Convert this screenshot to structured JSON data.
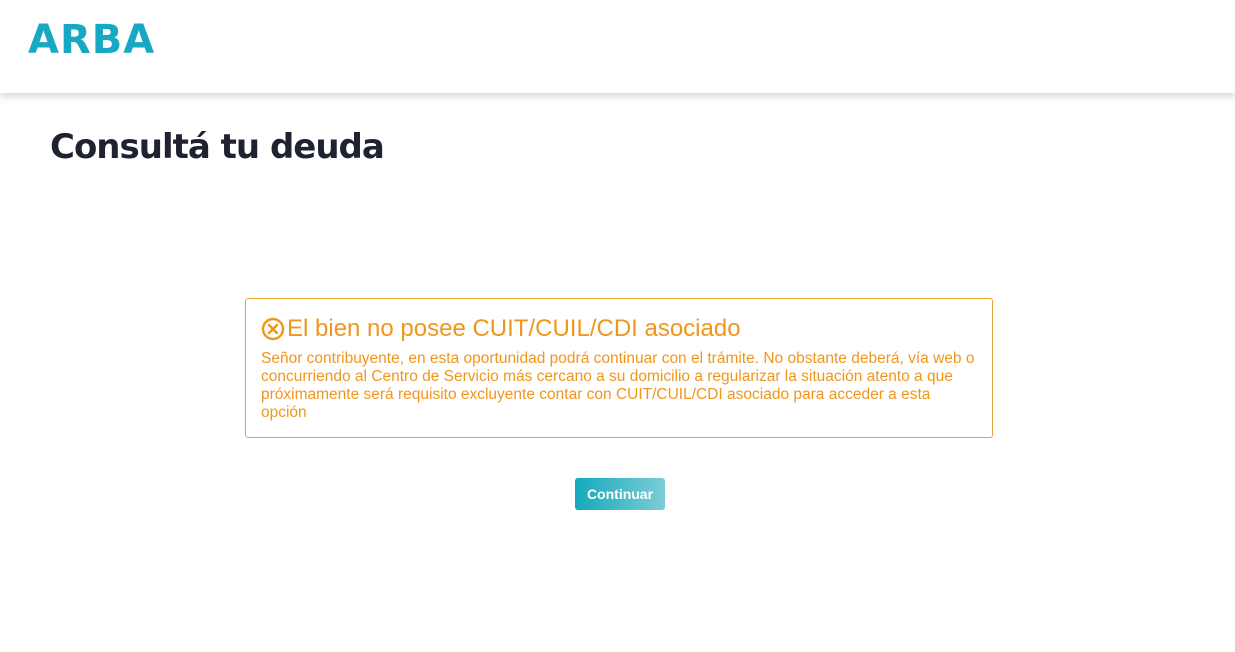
{
  "header": {
    "logo_text": "ARBA"
  },
  "page": {
    "title": "Consultá tu deuda"
  },
  "alert": {
    "icon": "circle-x-icon",
    "title": "El bien no posee CUIT/CUIL/CDI asociado",
    "message": "Señor contribuyente, en esta oportunidad podrá continuar con el trámite. No obstante deberá, vía web o concurriendo al Centro de Servicio más cercano a su domicilio a regularizar la situación atento a que próximamente será requisito excluyente contar con CUIT/CUIL/CDI asociado para acceder a esta opción",
    "color": "#f0961c"
  },
  "actions": {
    "continue_label": "Continuar"
  },
  "colors": {
    "brand": "#17a9c3",
    "warning": "#f0961c",
    "title": "#1f2230"
  }
}
